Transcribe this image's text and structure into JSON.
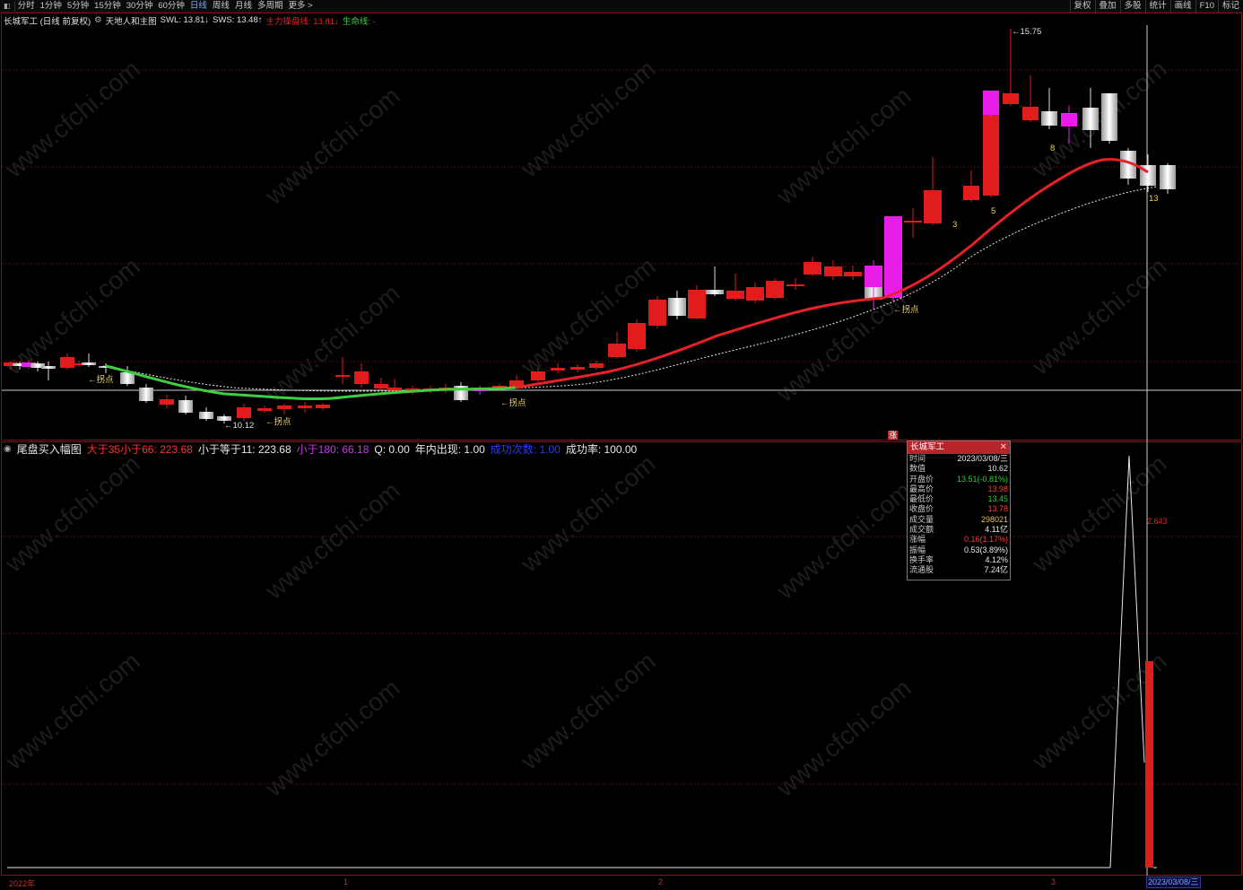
{
  "toolbar": {
    "left_items": [
      "分时",
      "1分钟",
      "5分钟",
      "15分钟",
      "30分钟",
      "60分钟",
      "日线",
      "周线",
      "月线",
      "多周期",
      "更多 >"
    ],
    "active_item": "日线",
    "right_items": [
      "复权",
      "叠加",
      "多股",
      "统计",
      "画线",
      "F10",
      "标记"
    ]
  },
  "header": {
    "stock_title": "长城军工 (日线 前复权)",
    "indicator_name": "天地人和主图",
    "swl": "SWL: 13.81↓",
    "sws": "SWS: 13.48↑",
    "main_line": "主力操盘线: 13.81↓",
    "life_line": "生命线: ·"
  },
  "main_chart": {
    "high_label": "15.75",
    "low_label": "10.12",
    "turn_label": "拐点",
    "wave_labels": [
      "3",
      "5",
      "8",
      "13"
    ],
    "rise_marker": "涨"
  },
  "indicator": {
    "name": "尾盘买入幅图",
    "gt35_lt66": "大于35小于66: 223.68",
    "le11": "小于等于11: 223.68",
    "lt180": "小于180: 66.18",
    "q": "Q: 0.00",
    "year_count": "年内出现: 1.00",
    "success_count": "成功次数: 1.00",
    "success_rate": "成功率: 100.00",
    "value_label": "2.643"
  },
  "tooltip": {
    "title": "长城军工",
    "rows": [
      {
        "k": "时间",
        "v": "2023/03/08/三",
        "color": "#e8e8e8"
      },
      {
        "k": "数值",
        "v": "10.62",
        "color": "#e8e8e8"
      },
      {
        "k": "开盘价",
        "v": "13.51(-0.81%)",
        "color": "#33cc33"
      },
      {
        "k": "最高价",
        "v": "13.98",
        "color": "#ff3b3b"
      },
      {
        "k": "最低价",
        "v": "13.45",
        "color": "#33cc33"
      },
      {
        "k": "收盘价",
        "v": "13.78",
        "color": "#ff3b3b"
      },
      {
        "k": "成交量",
        "v": "298021",
        "color": "#e8c040"
      },
      {
        "k": "成交额",
        "v": "4.11亿",
        "color": "#e8e8e8"
      },
      {
        "k": "涨幅",
        "v": "0.16(1.17%)",
        "color": "#ff3b3b"
      },
      {
        "k": "振幅",
        "v": "0.53(3.89%)",
        "color": "#e8e8e8"
      },
      {
        "k": "换手率",
        "v": "4.12%",
        "color": "#e8e8e8"
      },
      {
        "k": "流通股",
        "v": "7.24亿",
        "color": "#e8e8e8"
      }
    ]
  },
  "xaxis": {
    "labels": [
      "2022年",
      "1",
      "2",
      "3"
    ],
    "cursor_date": "2023/03/08/三"
  },
  "watermark": "www.cfchi.com",
  "colors": {
    "up": "#e01c1c",
    "down": "#e8e8e8",
    "magenta": "#e81ee8",
    "red_line": "#e8202a",
    "green_line": "#3ecf3e",
    "grid": "#4a0c0c",
    "indicator_red": "#ff3030",
    "indicator_purple": "#c03ce0"
  }
}
